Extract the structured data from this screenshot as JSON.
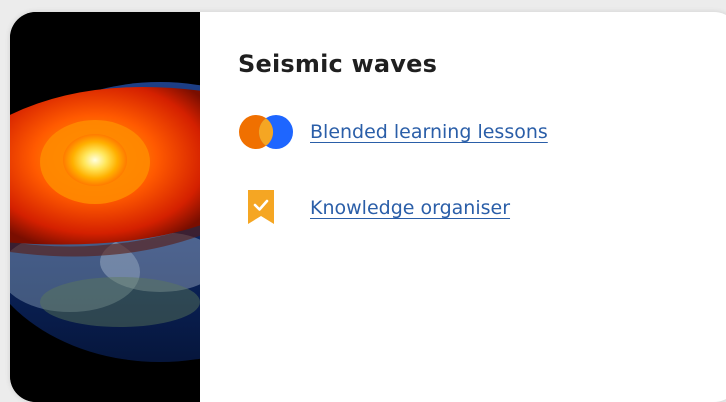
{
  "card": {
    "title": "Seismic waves",
    "links": [
      {
        "label": "Blended learning lessons",
        "icon": "venn-circles-icon"
      },
      {
        "label": "Knowledge organiser ",
        "icon": "bookmark-check-icon"
      }
    ]
  },
  "image": {
    "subject": "earth-core-cross-section-image"
  },
  "colors": {
    "link": "#2a5ea8",
    "title": "#1f1f1f",
    "venn_orange": "#f07000",
    "venn_blue": "#1e66ff",
    "venn_overlap": "#f5a623",
    "bookmark": "#f5a623"
  }
}
